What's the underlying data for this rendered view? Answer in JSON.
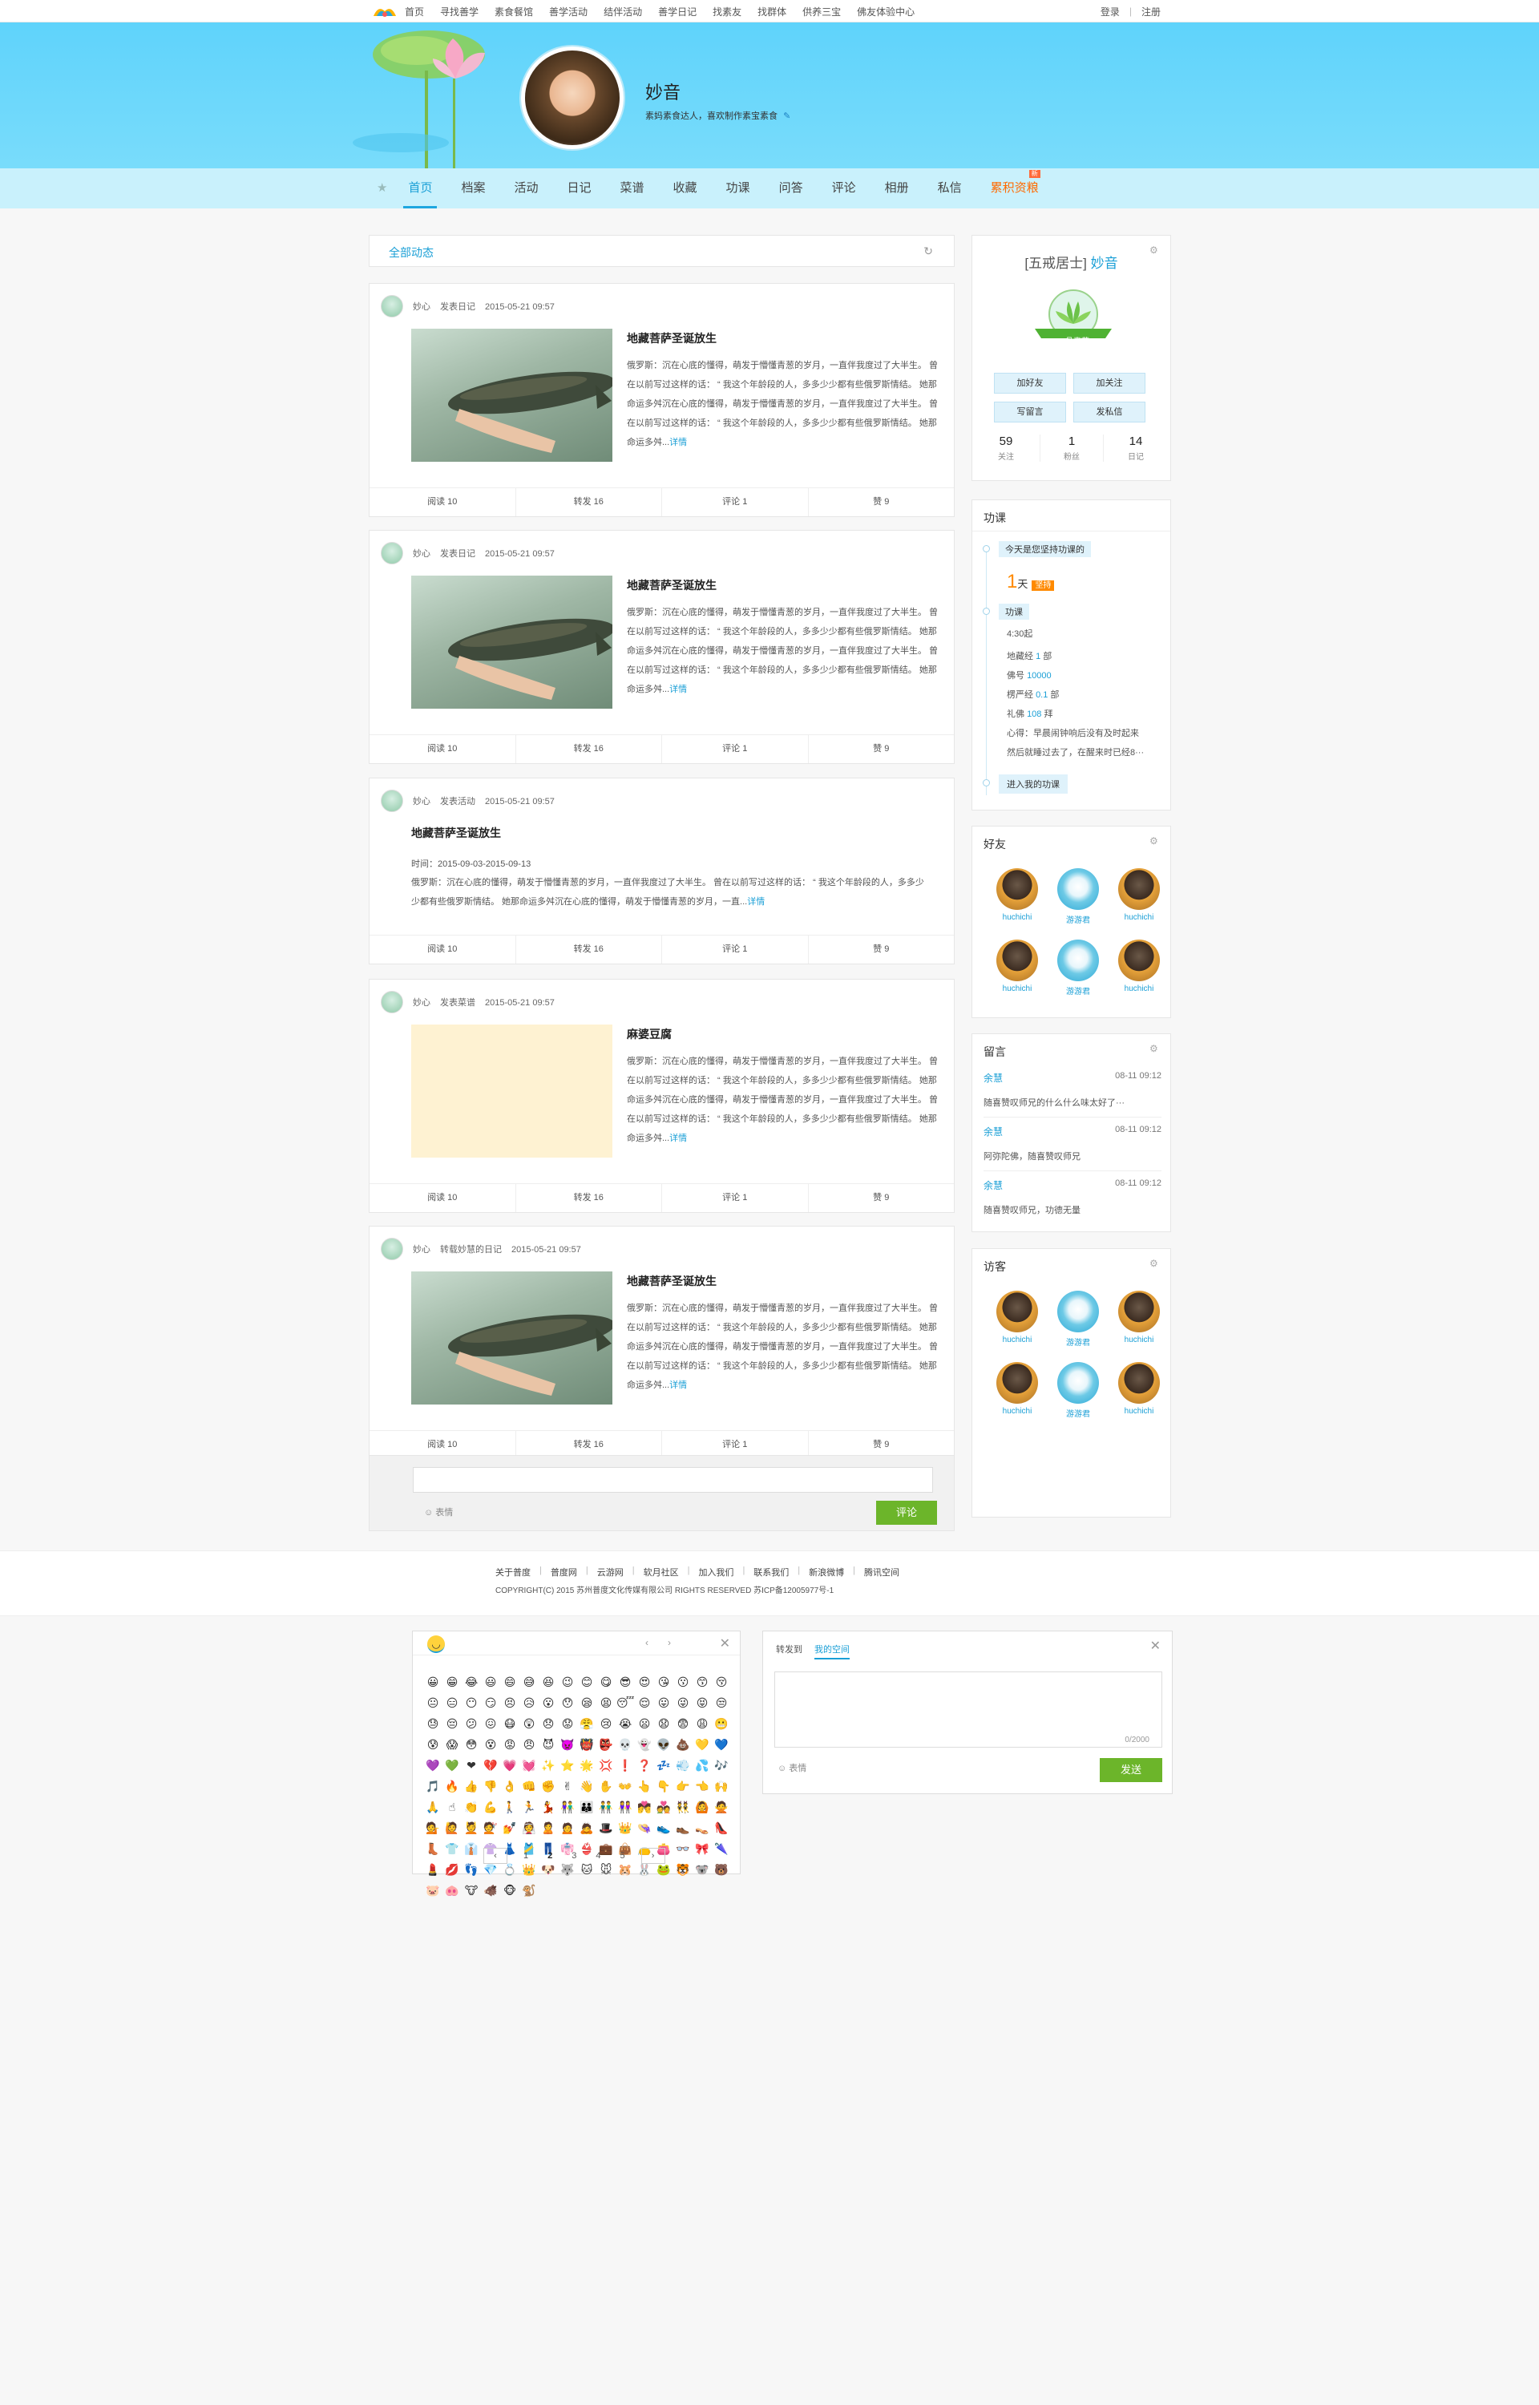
{
  "topnav": {
    "items": [
      "首页",
      "寻找善学",
      "素食餐馆",
      "善学活动",
      "结伴活动",
      "善学日记",
      "找素友",
      "找群体",
      "供养三宝",
      "佛友体验中心"
    ]
  },
  "toplinks": {
    "login": "登录",
    "register": "注册"
  },
  "profile": {
    "name": "妙音",
    "desc": "素妈素食达人，喜欢制作素宝素食"
  },
  "nav": {
    "items": [
      {
        "label": "首页",
        "active": true
      },
      {
        "label": "档案"
      },
      {
        "label": "活动"
      },
      {
        "label": "日记"
      },
      {
        "label": "菜谱"
      },
      {
        "label": "收藏"
      },
      {
        "label": "功课"
      },
      {
        "label": "问答"
      },
      {
        "label": "评论"
      },
      {
        "label": "相册"
      },
      {
        "label": "私信"
      },
      {
        "label": "累积资粮",
        "hot": true,
        "tag": "新"
      }
    ]
  },
  "feed": {
    "header": "全部动态",
    "posts": [
      {
        "user": "妙心",
        "action": "发表日记",
        "time": "2015-05-21 09:57",
        "title": "地藏菩萨圣诞放生",
        "body": "俄罗斯：沉在心底的懂得，萌发于懵懂青葱的岁月，一直伴我度过了大半生。 曾在以前写过这样的话： “ 我这个年龄段的人，多多少少都有些俄罗斯情结。 她那命运多舛沉在心底的懂得，萌发于懵懂青葱的岁月，一直伴我度过了大半生。 曾在以前写过这样的话： “ 我这个年龄段的人，多多少少都有些俄罗斯情结。 她那命运多舛...",
        "more": "详情",
        "thumb": "fish",
        "read": "阅读 10",
        "forward": "转发 16",
        "comment": "评论 1",
        "like": "赞 9"
      },
      {
        "user": "妙心",
        "action": "发表日记",
        "time": "2015-05-21 09:57",
        "title": "地藏菩萨圣诞放生",
        "body": "俄罗斯：沉在心底的懂得，萌发于懵懂青葱的岁月，一直伴我度过了大半生。 曾在以前写过这样的话： “ 我这个年龄段的人，多多少少都有些俄罗斯情结。 她那命运多舛沉在心底的懂得，萌发于懵懂青葱的岁月，一直伴我度过了大半生。 曾在以前写过这样的话： “ 我这个年龄段的人，多多少少都有些俄罗斯情结。 她那命运多舛...",
        "more": "详情",
        "thumb": "fish",
        "read": "阅读 10",
        "forward": "转发 16",
        "comment": "评论 1",
        "like": "赞 9"
      },
      {
        "user": "妙心",
        "action": "发表活动",
        "time": "2015-05-21 09:57",
        "title": "地藏菩萨圣诞放生",
        "dates": "时间：2015-09-03-2015-09-13",
        "body": "俄罗斯：沉在心底的懂得，萌发于懵懂青葱的岁月，一直伴我度过了大半生。 曾在以前写过这样的话： “ 我这个年龄段的人，多多少少都有些俄罗斯情结。 她那命运多舛沉在心底的懂得，萌发于懵懂青葱的岁月，一直...",
        "more": "详情",
        "read": "阅读 10",
        "forward": "转发 16",
        "comment": "评论 1",
        "like": "赞 9"
      },
      {
        "user": "妙心",
        "action": "发表菜谱",
        "time": "2015-05-21 09:57",
        "title": "麻婆豆腐",
        "body": "俄罗斯：沉在心底的懂得，萌发于懵懂青葱的岁月，一直伴我度过了大半生。 曾在以前写过这样的话： “ 我这个年龄段的人，多多少少都有些俄罗斯情结。 她那命运多舛沉在心底的懂得，萌发于懵懂青葱的岁月，一直伴我度过了大半生。 曾在以前写过这样的话： “ 我这个年龄段的人，多多少少都有些俄罗斯情结。 她那命运多舛...",
        "more": "详情",
        "thumb": "tofu",
        "read": "阅读 10",
        "forward": "转发 16",
        "comment": "评论 1",
        "like": "赞 9"
      },
      {
        "user": "妙心",
        "action": "转载妙慧的日记",
        "time": "2015-05-21 09:57",
        "title": "地藏菩萨圣诞放生",
        "body": "俄罗斯：沉在心底的懂得，萌发于懵懂青葱的岁月，一直伴我度过了大半生。 曾在以前写过这样的话： “ 我这个年龄段的人，多多少少都有些俄罗斯情结。 她那命运多舛沉在心底的懂得，萌发于懵懂青葱的岁月，一直伴我度过了大半生。 曾在以前写过这样的话： “ 我这个年龄段的人，多多少少都有些俄罗斯情结。 她那命运多舛...",
        "more": "详情",
        "thumb": "fish",
        "read": "阅读 10",
        "forward": "转发 16",
        "comment": "评论 1",
        "like": "赞 9"
      }
    ],
    "comment_emoji": "表情",
    "comment_button": "评论"
  },
  "side_profile": {
    "rank": "[五戒居士]",
    "name": "妙音",
    "badge": "一品青莲",
    "btn_add_friend": "加好友",
    "btn_follow": "加关注",
    "btn_message": "写留言",
    "btn_pm": "发私信",
    "following_n": "59",
    "following_l": "关注",
    "fans_n": "1",
    "fans_l": "粉丝",
    "diary_n": "14",
    "diary_l": "日记"
  },
  "gongke": {
    "title": "功课",
    "today": "今天是您坚持功课的",
    "days": "1",
    "days_unit": "天",
    "streak_tag": "坚持",
    "label": "功课",
    "time": "4:30起",
    "lines": [
      {
        "label": "地藏经",
        "value": "1",
        "unit": "部"
      },
      {
        "label": "佛号",
        "value": "10000",
        "unit": ""
      },
      {
        "label": "楞严经",
        "value": "0.1",
        "unit": "部"
      },
      {
        "label": "礼佛",
        "value": "108",
        "unit": "拜"
      }
    ],
    "heart1": "心得：早晨闹钟响后没有及时起来",
    "heart2": "然后就睡过去了，在醒来时已经8···",
    "enter": "进入我的功课"
  },
  "friends": {
    "title": "好友",
    "items": [
      {
        "name": "huchichi",
        "av": "dark"
      },
      {
        "name": "游游君",
        "av": "blue"
      },
      {
        "name": "huchichi",
        "av": "dark"
      },
      {
        "name": "huchichi",
        "av": "dark"
      },
      {
        "name": "游游君",
        "av": "blue"
      },
      {
        "name": "huchichi",
        "av": "dark"
      }
    ]
  },
  "messages": {
    "title": "留言",
    "items": [
      {
        "name": "余慧",
        "time": "08-11 09:12",
        "text": "随喜赞叹师兄的什么什么味太好了···"
      },
      {
        "name": "余慧",
        "time": "08-11 09:12",
        "text": "阿弥陀佛，随喜赞叹师兄"
      },
      {
        "name": "余慧",
        "time": "08-11 09:12",
        "text": "随喜赞叹师兄，功德无量"
      }
    ]
  },
  "visitors": {
    "title": "访客",
    "items": [
      {
        "name": "huchichi",
        "av": "dark"
      },
      {
        "name": "游游君",
        "av": "blue"
      },
      {
        "name": "huchichi",
        "av": "dark"
      },
      {
        "name": "huchichi",
        "av": "dark"
      },
      {
        "name": "游游君",
        "av": "blue"
      },
      {
        "name": "huchichi",
        "av": "dark"
      }
    ]
  },
  "footer": {
    "links": [
      "关于普度",
      "普度网",
      "云游网",
      "软月社区",
      "加入我们",
      "联系我们",
      "新浪微博",
      "腾讯空间"
    ],
    "copyright": "COPYRIGHT(C) 2015 苏州普度文化传媒有限公司 RIGHTS RESERVED 苏ICP备12005977号-1"
  },
  "emoji_panel": {
    "pages": [
      "1",
      "2",
      "3",
      "4",
      "5"
    ],
    "current": "2",
    "emojis": [
      "😀",
      "😁",
      "😂",
      "😃",
      "😄",
      "😅",
      "😆",
      "😉",
      "😊",
      "😋",
      "😎",
      "😍",
      "😘",
      "😗",
      "😙",
      "😚",
      "😐",
      "😑",
      "😶",
      "😏",
      "😣",
      "😥",
      "😮",
      "😯",
      "😪",
      "😫",
      "😴",
      "😌",
      "😛",
      "😜",
      "😝",
      "😒",
      "😓",
      "😔",
      "😕",
      "😖",
      "😷",
      "😲",
      "😞",
      "😟",
      "😤",
      "😢",
      "😭",
      "😦",
      "😧",
      "😨",
      "😩",
      "😬",
      "😰",
      "😱",
      "😳",
      "😵",
      "😡",
      "😠",
      "😈",
      "👿",
      "👹",
      "👺",
      "💀",
      "👻",
      "👽",
      "💩",
      "💛",
      "💙",
      "💜",
      "💚",
      "❤",
      "💔",
      "💗",
      "💓",
      "✨",
      "⭐",
      "🌟",
      "💢",
      "❗",
      "❓",
      "💤",
      "💨",
      "💦",
      "🎶",
      "🎵",
      "🔥",
      "👍",
      "👎",
      "👌",
      "👊",
      "✊",
      "✌",
      "👋",
      "✋",
      "👐",
      "👆",
      "👇",
      "👉",
      "👈",
      "🙌",
      "🙏",
      "☝",
      "👏",
      "💪",
      "🚶",
      "🏃",
      "💃",
      "👫",
      "👪",
      "👬",
      "👭",
      "💏",
      "💑",
      "👯",
      "🙆",
      "🙅",
      "💁",
      "🙋",
      "💆",
      "💇",
      "💅",
      "👰",
      "🙎",
      "🙍",
      "🙇",
      "🎩",
      "👑",
      "👒",
      "👟",
      "👞",
      "👡",
      "👠",
      "👢",
      "👕",
      "👔",
      "👚",
      "👗",
      "🎽",
      "👖",
      "👘",
      "👙",
      "💼",
      "👜",
      "👝",
      "👛",
      "👓",
      "🎀",
      "🌂",
      "💄",
      "💋",
      "👣",
      "💎",
      "💍",
      "👑",
      "🐶",
      "🐺",
      "🐱",
      "🐭",
      "🐹",
      "🐰",
      "🐸",
      "🐯",
      "🐨",
      "🐻",
      "🐷",
      "🐽",
      "🐮",
      "🐗",
      "🐵",
      "🐒"
    ]
  },
  "share_panel": {
    "tab1": "转发到",
    "tab2": "我的空间",
    "counter": "0/2000",
    "emoji": "表情",
    "send": "发送"
  }
}
